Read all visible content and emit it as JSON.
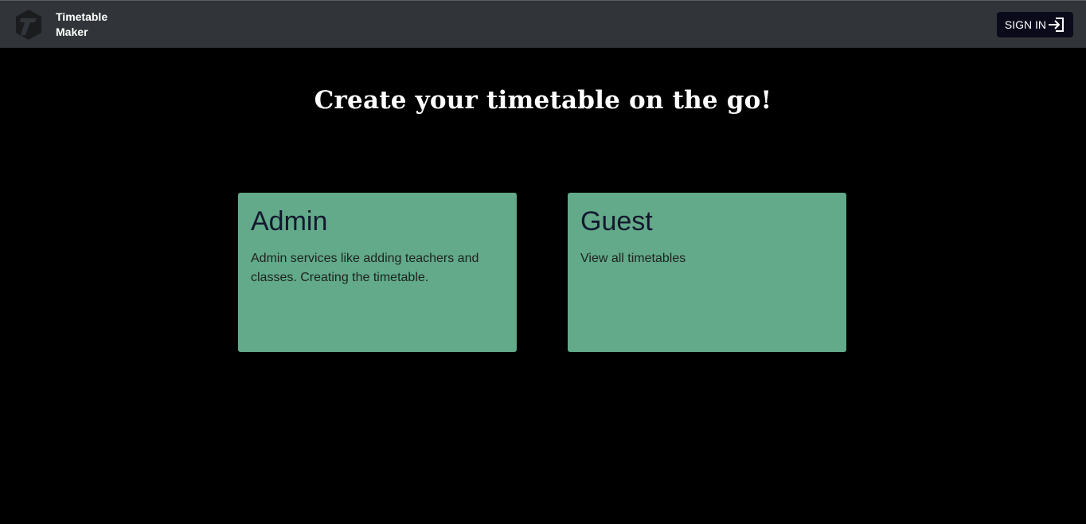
{
  "navbar": {
    "brand_line1": "Timetable",
    "brand_line2": "Maker",
    "signin_label": "SIGN IN",
    "logo_icon": "timetable-maker-logo-icon",
    "signin_icon": "sign-in-arrow-icon"
  },
  "hero": {
    "title": "Create your timetable on the go!"
  },
  "cards": [
    {
      "title": "Admin",
      "text": "Admin services like adding teachers and classes. Creating the timetable."
    },
    {
      "title": "Guest",
      "text": "View all timetables"
    }
  ],
  "colors": {
    "navbar_bg": "#313539",
    "page_bg": "#000000",
    "card_bg": "#62aa89",
    "card_title": "#14182f",
    "signin_bg": "#0a0a1a"
  }
}
